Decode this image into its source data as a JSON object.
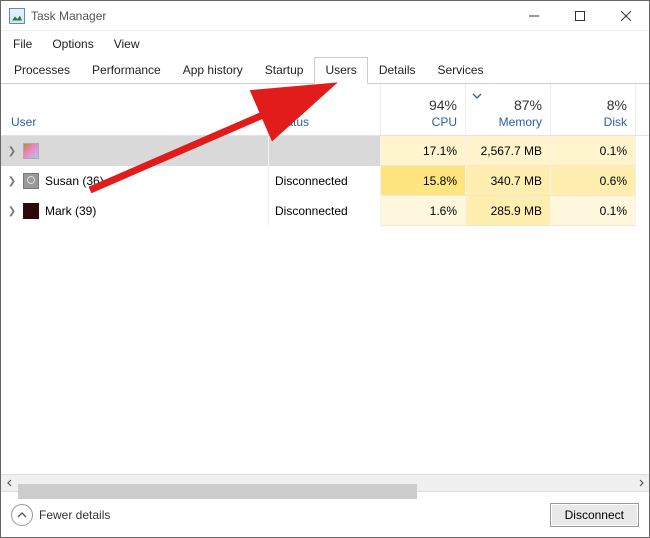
{
  "window": {
    "title": "Task Manager"
  },
  "menu": [
    "File",
    "Options",
    "View"
  ],
  "tabs": [
    {
      "label": "Processes",
      "active": false
    },
    {
      "label": "Performance",
      "active": false
    },
    {
      "label": "App history",
      "active": false
    },
    {
      "label": "Startup",
      "active": false
    },
    {
      "label": "Users",
      "active": true
    },
    {
      "label": "Details",
      "active": false
    },
    {
      "label": "Services",
      "active": false
    }
  ],
  "columns": {
    "user": "User",
    "status": "Status",
    "metrics": [
      {
        "pct": "94%",
        "label": "CPU",
        "sorted": false
      },
      {
        "pct": "87%",
        "label": "Memory",
        "sorted": true
      },
      {
        "pct": "8%",
        "label": "Disk",
        "sorted": false
      }
    ]
  },
  "rows": [
    {
      "name": "",
      "iconClass": "ui-pic",
      "status": "",
      "selected": true,
      "cells": [
        {
          "v": "17.1%",
          "heat": "heat-sel"
        },
        {
          "v": "2,567.7 MB",
          "heat": "heat-sel"
        },
        {
          "v": "0.1%",
          "heat": "heat-sel"
        }
      ]
    },
    {
      "name": "Susan (36)",
      "iconClass": "ui-gray",
      "status": "Disconnected",
      "selected": false,
      "cells": [
        {
          "v": "15.8%",
          "heat": "heat-2"
        },
        {
          "v": "340.7 MB",
          "heat": "heat-1"
        },
        {
          "v": "0.6%",
          "heat": "heat-1"
        }
      ]
    },
    {
      "name": "Mark (39)",
      "iconClass": "ui-dark",
      "status": "Disconnected",
      "selected": false,
      "cells": [
        {
          "v": "1.6%",
          "heat": "heat-0"
        },
        {
          "v": "285.9 MB",
          "heat": "heat-1"
        },
        {
          "v": "0.1%",
          "heat": "heat-0"
        }
      ]
    }
  ],
  "footer": {
    "fewer": "Fewer details",
    "disconnect": "Disconnect"
  }
}
